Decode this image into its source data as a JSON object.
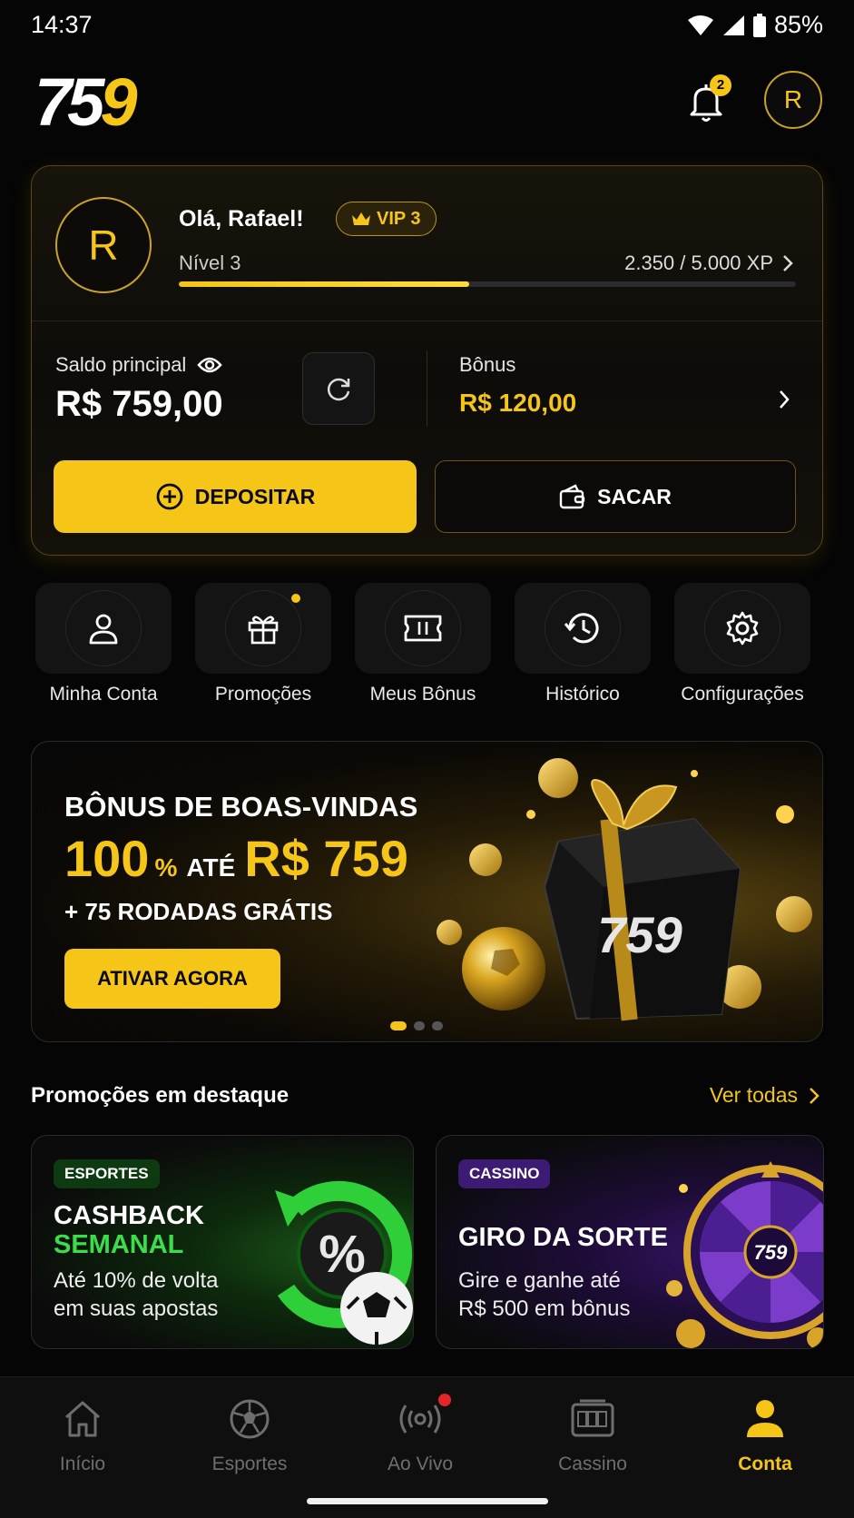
{
  "status": {
    "time": "14:37",
    "battery": "85%"
  },
  "header": {
    "logo_white": "75",
    "logo_yellow": "9",
    "notifications_count": "2",
    "avatar_initial": "R"
  },
  "account": {
    "avatar_initial": "R",
    "greeting": "Olá, Rafael!",
    "vip_label": "VIP 3",
    "level_label": "Nível 3",
    "xp_text": "2.350 / 5.000 XP",
    "xp_progress": 0.47,
    "balance_label": "Saldo principal",
    "balance_value": "R$ 759,00",
    "bonus_label": "Bônus",
    "bonus_value": "R$ 120,00",
    "deposit_label": "DEPOSITAR",
    "withdraw_label": "SACAR"
  },
  "quick_actions": [
    {
      "label": "Minha Conta",
      "icon": "user-icon"
    },
    {
      "label": "Promoções",
      "icon": "gift-icon"
    },
    {
      "label": "Meus Bônus",
      "icon": "ticket-icon"
    },
    {
      "label": "Histórico",
      "icon": "history-icon"
    },
    {
      "label": "Configurações",
      "icon": "gear-icon"
    }
  ],
  "banner": {
    "title": "BÔNUS DE BOAS-VINDAS",
    "percent": "100",
    "percent_sign": "%",
    "ate": "ATÉ",
    "amount": "R$ 759",
    "subtitle": "+ 75 RODADAS GRÁTIS",
    "cta": "ATIVAR AGORA",
    "box_logo": "759"
  },
  "featured": {
    "title": "Promoções em destaque",
    "see_all": "Ver todas",
    "cards": [
      {
        "tag": "ESPORTES",
        "title_1": "CASHBACK",
        "title_2": "SEMANAL",
        "desc_1": "Até 10% de volta",
        "desc_2": "em suas apostas"
      },
      {
        "tag": "CASSINO",
        "title_1": "GIRO DA SORTE",
        "desc_1": "Gire e ganhe até",
        "desc_2": "R$ 500 em bônus",
        "wheel_logo": "759"
      }
    ]
  },
  "nav": [
    {
      "label": "Início",
      "icon": "home-icon"
    },
    {
      "label": "Esportes",
      "icon": "soccer-ball-icon"
    },
    {
      "label": "Ao Vivo",
      "icon": "live-icon"
    },
    {
      "label": "Cassino",
      "icon": "slot-machine-icon"
    },
    {
      "label": "Conta",
      "icon": "user-icon"
    }
  ],
  "colors": {
    "accent": "#f5c518",
    "background": "#050505",
    "green": "#3ddc4a",
    "purple": "#7a3cc9"
  }
}
